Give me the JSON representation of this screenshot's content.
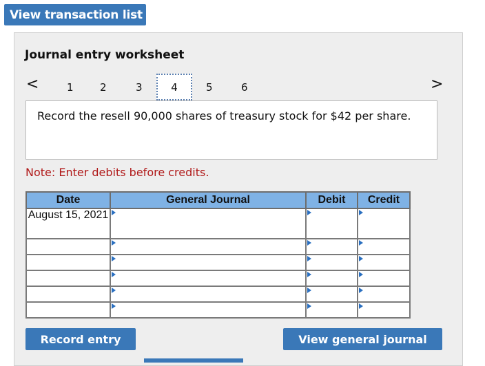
{
  "header": {
    "view_transaction_list_label": "View transaction list"
  },
  "worksheet": {
    "title": "Journal entry worksheet",
    "nav": {
      "prev": "<",
      "next": ">"
    },
    "steps": [
      "1",
      "2",
      "3",
      "4",
      "5",
      "6"
    ],
    "active_step": "4",
    "prompt": "Record the resell 90,000 shares of treasury stock for $42 per share.",
    "note": "Note: Enter debits before credits."
  },
  "table": {
    "columns": [
      "Date",
      "General Journal",
      "Debit",
      "Credit"
    ],
    "rows": [
      {
        "date": "August 15, 2021",
        "account": "",
        "debit": "",
        "credit": ""
      },
      {
        "date": "",
        "account": "",
        "debit": "",
        "credit": ""
      },
      {
        "date": "",
        "account": "",
        "debit": "",
        "credit": ""
      },
      {
        "date": "",
        "account": "",
        "debit": "",
        "credit": ""
      },
      {
        "date": "",
        "account": "",
        "debit": "",
        "credit": ""
      },
      {
        "date": "",
        "account": "",
        "debit": "",
        "credit": ""
      }
    ]
  },
  "buttons": {
    "record_entry": "Record entry",
    "view_general_journal": "View general journal"
  },
  "colors": {
    "button_blue": "#3a78b8",
    "header_blue": "#7fb2e5",
    "note_red": "#b01818",
    "panel_gray": "#eeeeee"
  }
}
